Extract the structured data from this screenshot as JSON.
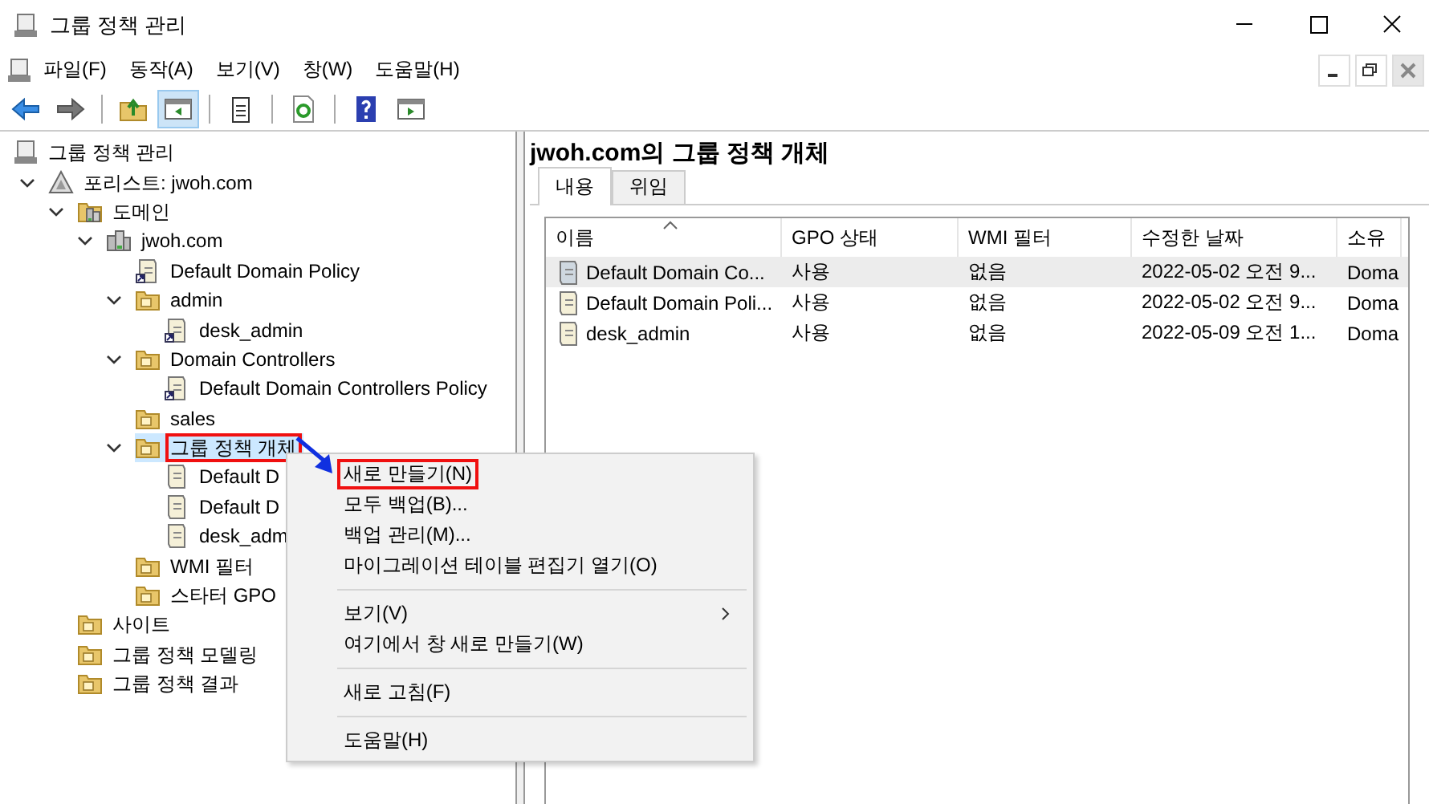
{
  "window": {
    "title": "그룹 정책 관리"
  },
  "menu_bar": [
    "파일(F)",
    "동작(A)",
    "보기(V)",
    "창(W)",
    "도움말(H)"
  ],
  "toolbar": [
    {
      "kind": "back",
      "pressed": false
    },
    {
      "kind": "forward",
      "pressed": false
    },
    {
      "kind": "sep"
    },
    {
      "kind": "up",
      "pressed": false
    },
    {
      "kind": "tree",
      "pressed": true
    },
    {
      "kind": "sep"
    },
    {
      "kind": "properties",
      "pressed": false
    },
    {
      "kind": "sep"
    },
    {
      "kind": "refresh",
      "pressed": false
    },
    {
      "kind": "sep"
    },
    {
      "kind": "help",
      "pressed": false
    },
    {
      "kind": "pane",
      "pressed": false
    }
  ],
  "tree": [
    {
      "label": "그룹 정책 관리",
      "kind": "console",
      "selected": false,
      "annotated": false,
      "children": [
        {
          "label": "포리스트: jwoh.com",
          "kind": "forest",
          "expanded": true,
          "selected": false,
          "annotated": false,
          "children": [
            {
              "label": "도메인",
              "kind": "domains",
              "expanded": true,
              "selected": false,
              "annotated": false,
              "children": [
                {
                  "label": "jwoh.com",
                  "kind": "server",
                  "expanded": true,
                  "selected": false,
                  "annotated": false,
                  "children": [
                    {
                      "label": "Default Domain Policy",
                      "kind": "link",
                      "selected": false,
                      "annotated": false
                    },
                    {
                      "label": "admin",
                      "kind": "folder",
                      "expanded": true,
                      "selected": false,
                      "annotated": false,
                      "children": [
                        {
                          "label": "desk_admin",
                          "kind": "link",
                          "selected": false,
                          "annotated": false
                        }
                      ]
                    },
                    {
                      "label": "Domain Controllers",
                      "kind": "folder",
                      "expanded": true,
                      "selected": false,
                      "annotated": false,
                      "children": [
                        {
                          "label": "Default Domain Controllers Policy",
                          "kind": "link",
                          "selected": false,
                          "annotated": false
                        }
                      ]
                    },
                    {
                      "label": "sales",
                      "kind": "folder",
                      "selected": false,
                      "annotated": false
                    },
                    {
                      "label": "그룹 정책 개체",
                      "kind": "folder",
                      "expanded": true,
                      "selected": true,
                      "annotated": true,
                      "children": [
                        {
                          "label": "Default D",
                          "kind": "scroll",
                          "selected": false,
                          "annotated": false
                        },
                        {
                          "label": "Default D",
                          "kind": "scroll",
                          "selected": false,
                          "annotated": false
                        },
                        {
                          "label": "desk_adm",
                          "kind": "scroll",
                          "selected": false,
                          "annotated": false
                        }
                      ]
                    },
                    {
                      "label": "WMI 필터",
                      "kind": "folder",
                      "selected": false,
                      "annotated": false
                    },
                    {
                      "label": "스타터 GPO",
                      "kind": "folder",
                      "selected": false,
                      "annotated": false
                    }
                  ]
                }
              ]
            },
            {
              "label": "사이트",
              "kind": "folder",
              "selected": false,
              "annotated": false
            },
            {
              "label": "그룹 정책 모델링",
              "kind": "folder",
              "selected": false,
              "annotated": false
            },
            {
              "label": "그룹 정책 결과",
              "kind": "folder",
              "selected": false,
              "annotated": false
            }
          ]
        }
      ]
    }
  ],
  "pane_title": "jwoh.com의 그룹 정책 개체",
  "tabs": [
    {
      "label": "내용",
      "selected": true
    },
    {
      "label": "위임",
      "selected": false
    }
  ],
  "table": {
    "columns": [
      {
        "label": "이름",
        "sorted": true
      },
      {
        "label": "GPO 상태",
        "sorted": false
      },
      {
        "label": "WMI 필터",
        "sorted": false
      },
      {
        "label": "수정한 날짜",
        "sorted": false
      },
      {
        "label": "소유",
        "sorted": false
      }
    ],
    "rows": [
      {
        "selected": true,
        "cells": [
          "Default Domain Co...",
          "사용",
          "없음",
          "2022-05-02 오전 9...",
          "Doma"
        ]
      },
      {
        "selected": false,
        "cells": [
          "Default Domain Poli...",
          "사용",
          "없음",
          "2022-05-02 오전 9...",
          "Doma"
        ]
      },
      {
        "selected": false,
        "cells": [
          "desk_admin",
          "사용",
          "없음",
          "2022-05-09 오전 1...",
          "Doma"
        ]
      }
    ]
  },
  "context_menu": [
    {
      "kind": "item",
      "label": "새로 만들기(N)",
      "annotated": true,
      "submenu": false
    },
    {
      "kind": "item",
      "label": "모두 백업(B)...",
      "annotated": false,
      "submenu": false
    },
    {
      "kind": "item",
      "label": "백업 관리(M)...",
      "annotated": false,
      "submenu": false
    },
    {
      "kind": "item",
      "label": "마이그레이션 테이블 편집기 열기(O)",
      "annotated": false,
      "submenu": false
    },
    {
      "kind": "separator"
    },
    {
      "kind": "item",
      "label": "보기(V)",
      "annotated": false,
      "submenu": true
    },
    {
      "kind": "item",
      "label": "여기에서 창 새로 만들기(W)",
      "annotated": false,
      "submenu": false
    },
    {
      "kind": "separator"
    },
    {
      "kind": "item",
      "label": "새로 고침(F)",
      "annotated": false,
      "submenu": false
    },
    {
      "kind": "separator"
    },
    {
      "kind": "item",
      "label": "도움말(H)",
      "annotated": false,
      "submenu": false
    }
  ]
}
